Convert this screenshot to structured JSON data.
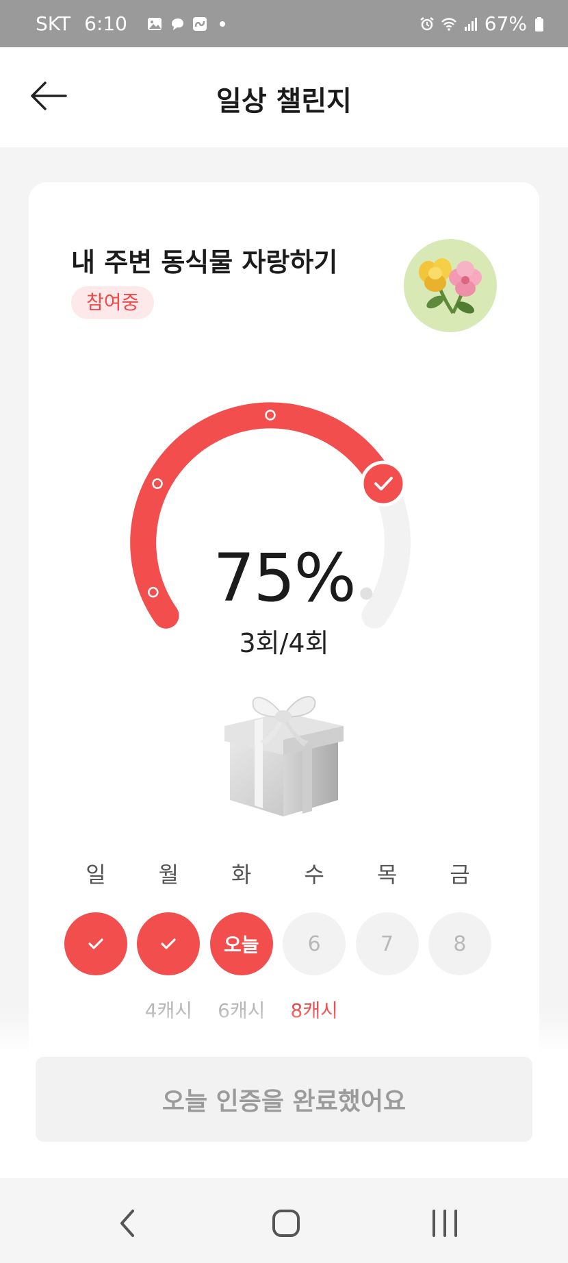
{
  "status_bar": {
    "carrier": "SKT",
    "time": "6:10",
    "battery": "67%"
  },
  "header": {
    "title": "일상 챌린지"
  },
  "challenge": {
    "title": "내 주변 동식물 자랑하기",
    "status": "참여중",
    "progress_fraction": 0.75,
    "percent_text": "75%",
    "count_text": "3회/4회"
  },
  "week": {
    "weekdays": [
      "일",
      "월",
      "화",
      "수",
      "목",
      "금"
    ],
    "days": [
      {
        "state": "done",
        "label": ""
      },
      {
        "state": "done",
        "label": ""
      },
      {
        "state": "today",
        "label": "오늘"
      },
      {
        "state": "future",
        "label": "6"
      },
      {
        "state": "future",
        "label": "7"
      },
      {
        "state": "future",
        "label": "8"
      }
    ],
    "rewards": [
      "",
      "4캐시",
      "6캐시",
      "8캐시",
      "",
      ""
    ]
  },
  "action": {
    "button_label": "오늘 인증을 완료했어요"
  },
  "colors": {
    "accent": "#f24e4e",
    "track": "#f2f2f2",
    "chip_bg": "#fde9e9"
  },
  "icons": {
    "back": "arrow-left-icon",
    "check": "check-icon",
    "gift": "gift-box-icon",
    "nav_back": "chevron-left-icon",
    "nav_home": "home-square-icon",
    "nav_recent": "recent-apps-icon"
  }
}
